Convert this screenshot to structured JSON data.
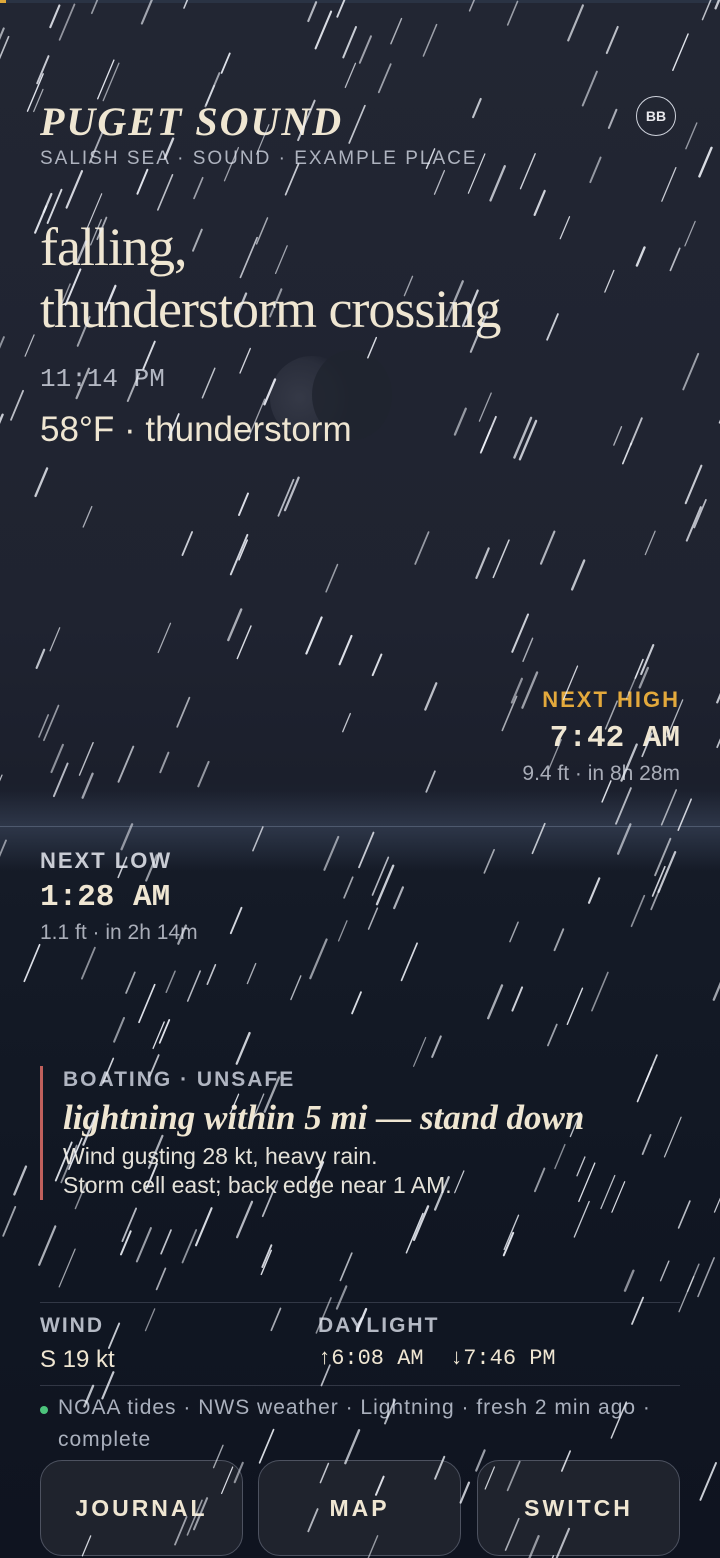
{
  "header": {
    "title": "PUGET SOUND",
    "subtitle": "SALISH SEA · SOUND · EXAMPLE PLACE",
    "avatar_initials": "BB"
  },
  "conditions": {
    "headline_line1": "falling,",
    "headline_line2": "thunderstorm crossing",
    "time": "11:14 PM",
    "temperature_summary": "58°F · thunderstorm"
  },
  "tides": {
    "next_high": {
      "label": "NEXT HIGH",
      "time": "7:42 AM",
      "detail": "9.4 ft · in 8h 28m"
    },
    "next_low": {
      "label": "NEXT LOW",
      "time": "1:28 AM",
      "detail": "1.1 ft · in 2h 14m"
    }
  },
  "advisory": {
    "label": "BOATING · UNSAFE",
    "headline": "lightning within 5 mi — stand down",
    "body_line1": "Wind gusting 28 kt, heavy rain.",
    "body_line2": "Storm cell east; back edge near 1 AM."
  },
  "stats": {
    "wind_label": "WIND",
    "wind_value": "S 19 kt",
    "daylight_label": "DAYLIGHT",
    "daylight_value": "↑6:08 AM  ↓7:46 PM"
  },
  "sources": {
    "text": "NOAA tides · NWS weather · Lightning · fresh 2 min ago · complete"
  },
  "buttons": {
    "journal": "JOURNAL",
    "map": "MAP",
    "switch": "SWITCH"
  },
  "colors": {
    "accent_high": "#e3a93c",
    "alert_bar": "#c0605c",
    "status_dot": "#4cc47c",
    "text_primary": "#efe6d2"
  }
}
